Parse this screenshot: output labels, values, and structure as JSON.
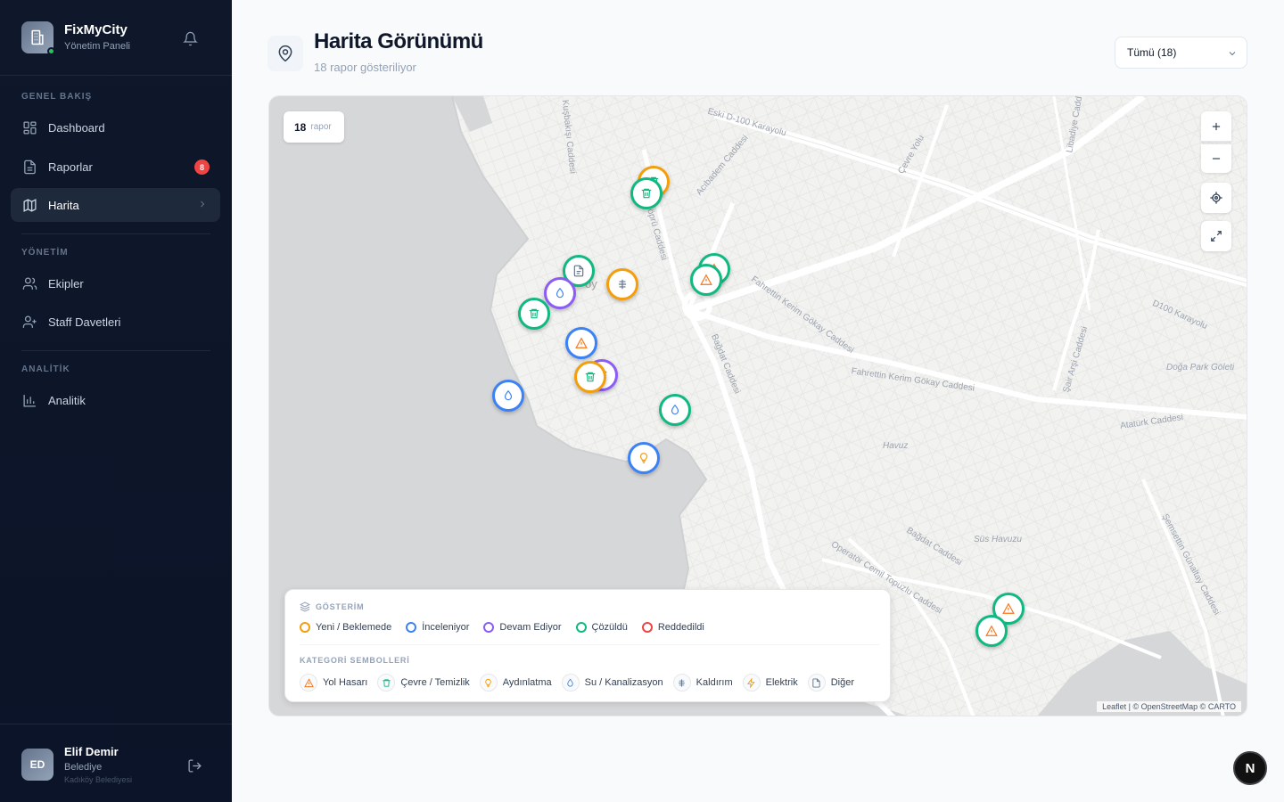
{
  "app": {
    "name": "FixMyCity",
    "subtitle": "Yönetim Paneli"
  },
  "sidebar": {
    "sections": [
      {
        "label": "GENEL BAKIŞ"
      },
      {
        "label": "YÖNETİM"
      },
      {
        "label": "ANALİTİK"
      }
    ],
    "items": [
      {
        "label": "Dashboard",
        "icon": "dashboard-icon"
      },
      {
        "label": "Raporlar",
        "icon": "file-icon",
        "badge": "8"
      },
      {
        "label": "Harita",
        "icon": "map-icon",
        "active": true
      },
      {
        "label": "Ekipler",
        "icon": "users-icon"
      },
      {
        "label": "Staff Davetleri",
        "icon": "user-plus-icon"
      },
      {
        "label": "Analitik",
        "icon": "bar-chart-icon"
      }
    ]
  },
  "user": {
    "initials": "ED",
    "name": "Elif Demir",
    "role": "Belediye",
    "org": "Kadıköy Belediyesi"
  },
  "header": {
    "title": "Harita Görünümü",
    "subtitle": "18 rapor gösteriliyor"
  },
  "filter": {
    "selected": "Tümü (18)"
  },
  "map": {
    "count": "18",
    "count_label": "rapor",
    "attribution": "Leaflet | © OpenStreetMap © CARTO",
    "place_labels": [
      "Doğa Park Göleti",
      "Havuz",
      "Süs Havuzu",
      "oy"
    ],
    "road_labels": [
      "Eski D-100 Karayolu",
      "Acıbadem Caddesi",
      "Çevre Yolu",
      "Fahrettin Kerim Gökay Caddesi",
      "D100 Karayolu",
      "Bağdat Caddesi",
      "Atatürk Caddesi",
      "Şair Arşi Caddesi",
      "Operatör Cemil Topuzlu Caddesi",
      "Şemsettin Günaltay Caddesi",
      "Taşköprü Caddesi",
      "Libadiye Caddesi",
      "Kuşbakışı Caddesi"
    ]
  },
  "legend": {
    "title": "GÖSTERİM",
    "statuses": [
      {
        "label": "Yeni / Beklemede",
        "color": "#f59e0b"
      },
      {
        "label": "İnceleniyor",
        "color": "#3b82f6"
      },
      {
        "label": "Devam Ediyor",
        "color": "#8b5cf6"
      },
      {
        "label": "Çözüldü",
        "color": "#10b981"
      },
      {
        "label": "Reddedildi",
        "color": "#ef4444"
      }
    ],
    "categories_title": "KATEGORİ SEMBOLLERİ",
    "categories": [
      {
        "label": "Yol Hasarı",
        "icon": "warning-icon",
        "color": "#f97316"
      },
      {
        "label": "Çevre / Temizlik",
        "icon": "trash-icon",
        "color": "#10b981"
      },
      {
        "label": "Aydınlatma",
        "icon": "lightbulb-icon",
        "color": "#f59e0b"
      },
      {
        "label": "Su / Kanalizasyon",
        "icon": "droplet-icon",
        "color": "#3b82f6"
      },
      {
        "label": "Kaldırım",
        "icon": "sidewalk-icon",
        "color": "#64748b"
      },
      {
        "label": "Elektrik",
        "icon": "bolt-icon",
        "color": "#f59e0b"
      },
      {
        "label": "Diğer",
        "icon": "document-icon",
        "color": "#64748b"
      }
    ]
  },
  "markers": [
    {
      "category": "trash",
      "status": "Yeni / Beklemede"
    },
    {
      "category": "trash",
      "status": "Çözüldü"
    },
    {
      "category": "warning",
      "status": "Çözüldü"
    },
    {
      "category": "warning",
      "status": "Çözüldü"
    },
    {
      "category": "document",
      "status": "Çözüldü"
    },
    {
      "category": "sidewalk",
      "status": "Yeni / Beklemede"
    },
    {
      "category": "droplet",
      "status": "Devam Ediyor"
    },
    {
      "category": "trash",
      "status": "Çözüldü"
    },
    {
      "category": "warning",
      "status": "İnceleniyor"
    },
    {
      "category": "trash",
      "status": "Devam Ediyor"
    },
    {
      "category": "trash",
      "status": "Yeni / Beklemede"
    },
    {
      "category": "droplet",
      "status": "İnceleniyor"
    },
    {
      "category": "droplet",
      "status": "Çözüldü"
    },
    {
      "category": "lightbulb",
      "status": "İnceleniyor"
    },
    {
      "category": "warning",
      "status": "Çözüldü"
    },
    {
      "category": "warning",
      "status": "Çözüldü"
    }
  ]
}
